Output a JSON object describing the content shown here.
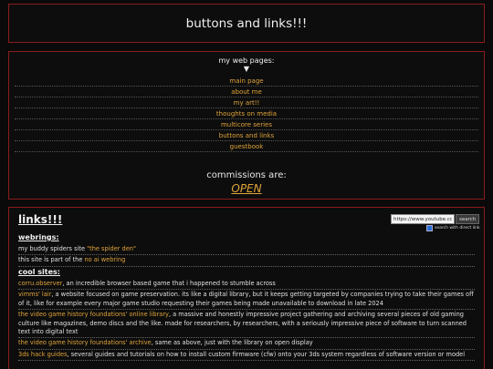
{
  "header": {
    "title": "buttons and links!!!"
  },
  "nav": {
    "heading": "my web pages:",
    "arrow": "▼",
    "items": [
      "main page",
      "about me",
      "my art!!",
      "thoughts on media",
      "multicore series",
      "buttons and links",
      "guestbook"
    ],
    "commissions_label": "commissions are:",
    "commissions_status": "OPEN"
  },
  "main": {
    "title": "links!!!",
    "search": {
      "value": "https://www.youtube.com/",
      "button": "search",
      "direct_label": "search with direct link"
    },
    "webrings": {
      "heading": "webrings:",
      "rows": [
        {
          "pre": "my buddy spiders site ",
          "link": "\"the spider den\"",
          "post": ""
        },
        {
          "pre": "this site is part of the ",
          "link": "no ai webring",
          "post": ""
        }
      ]
    },
    "cool_sites": {
      "heading": "cool sites:",
      "rows": [
        {
          "link": "corru.observer",
          "text": ", an incredible browser based game that i happened to stumble across"
        },
        {
          "link": "vimms' lair",
          "text": ", a website focused on game preservation. its like a digital library, but it keeps getting targeted by companies trying to take their games off of it, like for example every major game studio requesting their games being made unavailable to download in late 2024"
        },
        {
          "link": "the video game history foundations' online library",
          "text": ", a massive and honestly impressive project gathering and archiving several pieces of old gaming culture like magazines, demo discs and the like. made for researchers, by researchers, with a seriously impressive piece of software to turn scanned text into digital text"
        },
        {
          "link": "the video game history foundations' archive",
          "text": ", same as above, just with the library on open display"
        },
        {
          "link": "3ds hack guides",
          "text": ", several guides and tutorials on how to install custom firmware (cfw) onto your 3ds system regardless of software version or model"
        }
      ]
    }
  }
}
